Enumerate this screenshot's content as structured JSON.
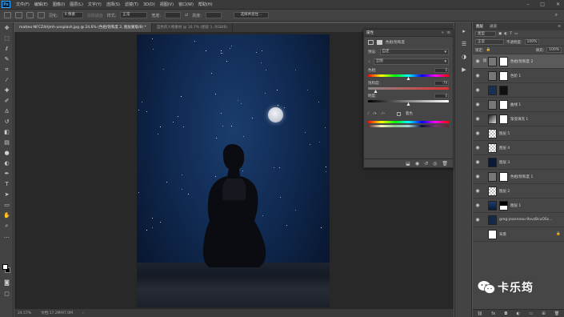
{
  "app": {
    "logo": "Ps"
  },
  "menu": [
    "文件(F)",
    "编辑(E)",
    "图像(I)",
    "图层(L)",
    "文字(Y)",
    "选择(S)",
    "滤镜(T)",
    "3D(D)",
    "视图(V)",
    "窗口(W)",
    "帮助(H)"
  ],
  "options": {
    "feather_label": "羽化:",
    "feather_value": "0 像素",
    "antialias": "消除锯齿",
    "style_label": "样式:",
    "style_value": "正常",
    "width_label": "宽度:",
    "height_label": "高度:",
    "mask_button": "选择并遮住..."
  },
  "tabs": [
    {
      "label": "matteo-NFCZ4HJmh-unsplash.jpg @ 24.6% (色相/饱和度 2, 图层蒙版/8) *"
    },
    {
      "label": "蓝色的人物素材 @ 16.7% (图层 1, RGB/8)"
    }
  ],
  "status": {
    "zoom": "24.57%",
    "doc": "文档:17.2M/97.0M"
  },
  "properties": {
    "title": "属性",
    "adj_name": "色相/饱和度",
    "preset_label": "预设:",
    "preset_value": "自定",
    "channel_value": "全图",
    "hue_label": "色相:",
    "hue_value": "0",
    "sat_label": "饱和度:",
    "sat_value": "-79",
    "light_label": "明度:",
    "light_value": "0",
    "colorize_label": "着色",
    "hue_pos": 0.5,
    "sat_pos": 0.1,
    "light_pos": 0.5
  },
  "layers_panel": {
    "tab1": "图层",
    "tab2": "通道",
    "kind": "类型",
    "mode": "正常",
    "opacity_label": "不透明度:",
    "opacity_value": "100%",
    "lock_label": "锁定:",
    "fill_label": "填充:",
    "fill_value": "100%",
    "layers": [
      {
        "name": "色相/饱和度 2",
        "selected": true
      },
      {
        "name": "色阶 1"
      },
      {
        "name": ""
      },
      {
        "name": "曲线 1"
      },
      {
        "name": "渐变填充 1"
      },
      {
        "name": "图层 5"
      },
      {
        "name": "图层 4"
      },
      {
        "name": "图层 3"
      },
      {
        "name": "色相/饱和度 1"
      },
      {
        "name": "图层 2"
      },
      {
        "name": "图层 1"
      },
      {
        "name": "greg-jeanneau-9ovzBcuOSs..."
      },
      {
        "name": "背景"
      }
    ]
  },
  "watermark": "卡乐筠"
}
